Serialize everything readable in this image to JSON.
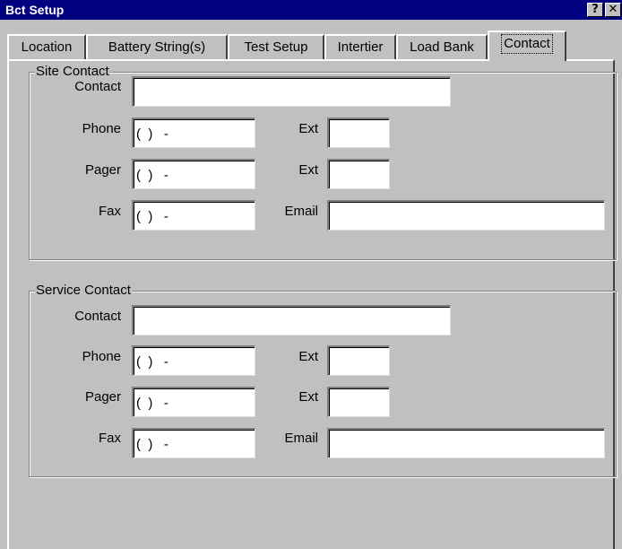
{
  "window": {
    "title": "Bct Setup",
    "help_glyph": "?",
    "close_glyph": "✕"
  },
  "tabs": [
    {
      "label": "Location"
    },
    {
      "label": "Battery String(s)"
    },
    {
      "label": "Test Setup"
    },
    {
      "label": "Intertier"
    },
    {
      "label": "Load Bank"
    },
    {
      "label": "Contact",
      "active": true
    }
  ],
  "site_contact": {
    "group_title": "Site Contact",
    "contact_label": "Contact",
    "contact_value": "",
    "phone_label": "Phone",
    "phone_value": "(  )   -",
    "phone_ext_label": "Ext",
    "phone_ext_value": "",
    "pager_label": "Pager",
    "pager_value": "(  )   -",
    "pager_ext_label": "Ext",
    "pager_ext_value": "",
    "fax_label": "Fax",
    "fax_value": "(  )   -",
    "email_label": "Email",
    "email_value": ""
  },
  "service_contact": {
    "group_title": "Service Contact",
    "contact_label": "Contact",
    "contact_value": "",
    "phone_label": "Phone",
    "phone_value": "(  )   -",
    "phone_ext_label": "Ext",
    "phone_ext_value": "",
    "pager_label": "Pager",
    "pager_value": "(  )   -",
    "pager_ext_label": "Ext",
    "pager_ext_value": "",
    "fax_label": "Fax",
    "fax_value": "(  )   -",
    "email_label": "Email",
    "email_value": ""
  },
  "colors": {
    "titlebar": "#000080",
    "face": "#c0c0c0",
    "field": "#ffffff"
  },
  "icons": [
    "help-icon",
    "close-icon"
  ]
}
